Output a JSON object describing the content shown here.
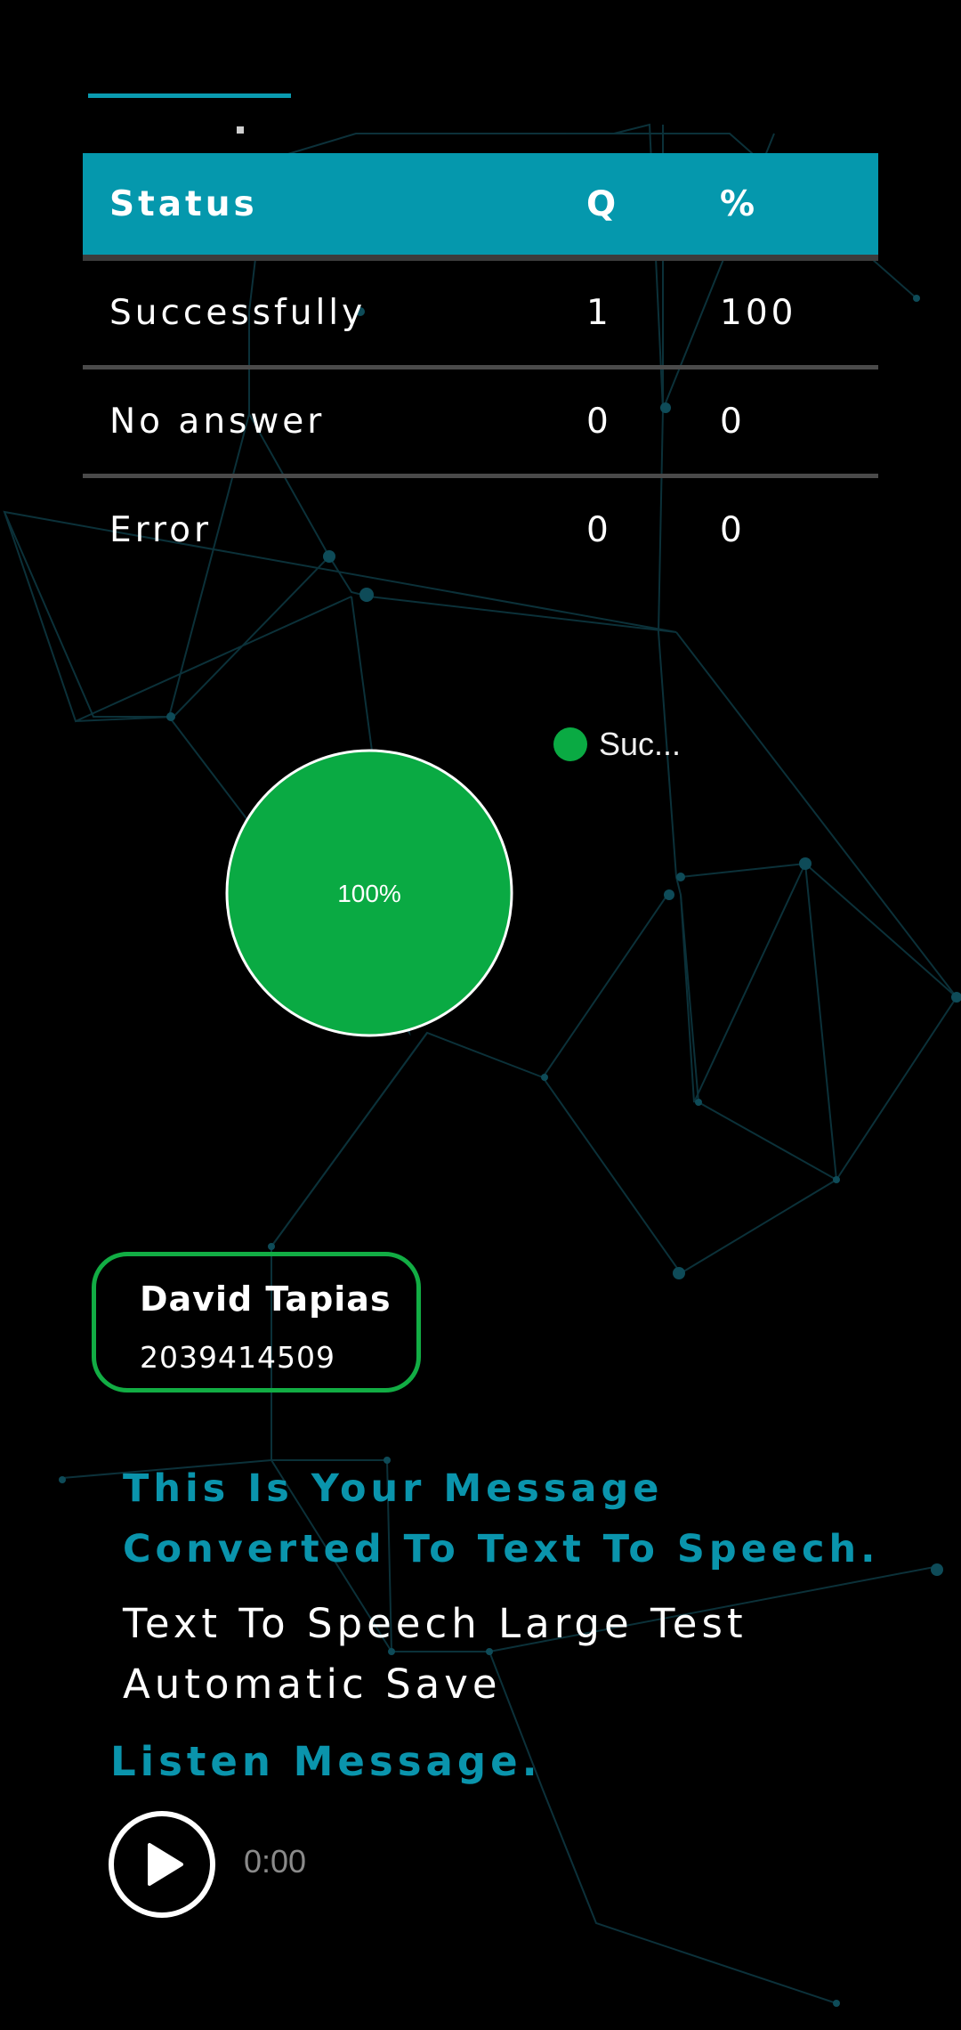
{
  "table": {
    "headers": {
      "status": "Status",
      "q": "Q",
      "percent": "%"
    },
    "rows": [
      {
        "status": "Successfully",
        "q": "1",
        "percent": "100"
      },
      {
        "status": "No answer",
        "q": "0",
        "percent": "0"
      },
      {
        "status": "Error",
        "q": "0",
        "percent": "0"
      }
    ]
  },
  "chart_data": {
    "type": "pie",
    "categories": [
      "Suc..."
    ],
    "values": [
      100
    ],
    "slice_labels": [
      "100%"
    ],
    "colors": [
      "#0aaa43"
    ],
    "legend_position": "top-right"
  },
  "contact": {
    "name": "David Tapias",
    "phone": "2039414509"
  },
  "message": {
    "heading": "This Is Your Message Converted To Text To Speech.",
    "body": "Text To Speech Large Test Automatic Save"
  },
  "listen": {
    "heading": "Listen Message.",
    "time": "0:00"
  },
  "colors": {
    "accent": "#0598ad",
    "success": "#0aaa43",
    "background": "#000000"
  },
  "icons": {
    "play": "play-icon"
  }
}
